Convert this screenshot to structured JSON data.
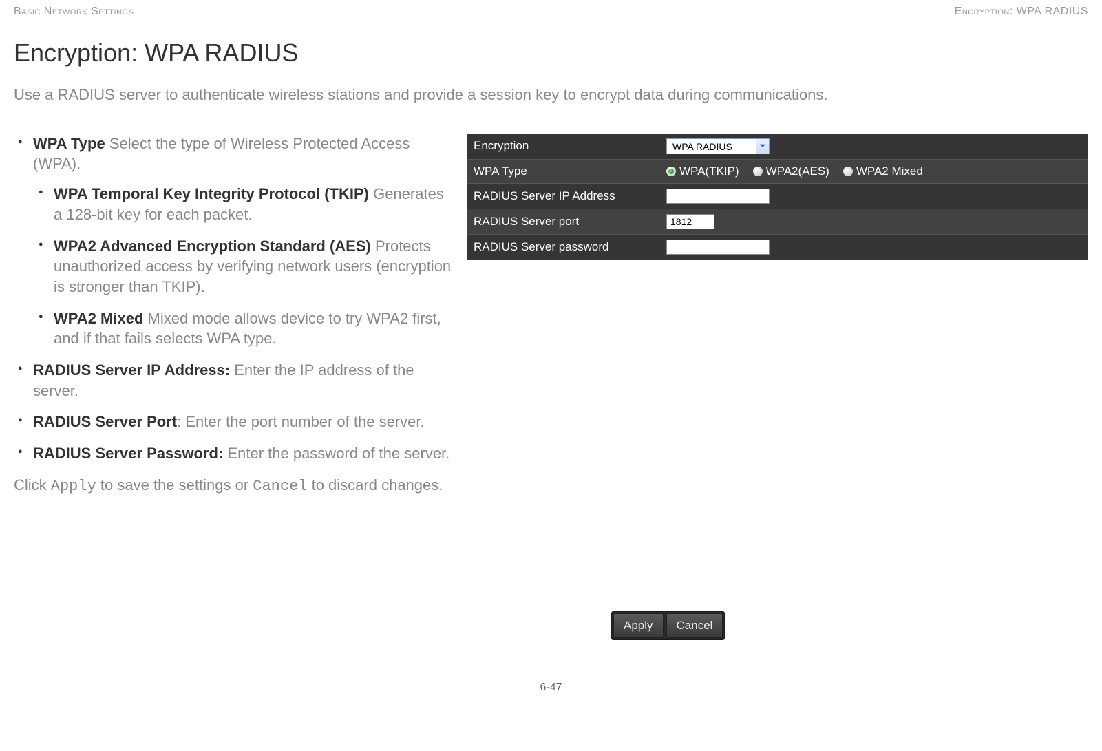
{
  "header": {
    "left": "Basic Network Settings",
    "right": "Encryption: WPA RADIUS"
  },
  "title": "Encryption: WPA RADIUS",
  "intro": "Use a RADIUS server to authenticate wireless stations and provide a session key to encrypt data during communications.",
  "bullets": {
    "wpaType": {
      "term": "WPA Type",
      "desc": "  Select the type of Wireless Protected Access (WPA).",
      "sub": {
        "tkip": {
          "term": "WPA Temporal Key Integrity Protocol (TKIP)",
          "desc": "  Generates a 128-bit key for each packet."
        },
        "aes": {
          "term": "WPA2 Advanced Encryption Standard (AES)",
          "desc": "  Protects unauthorized access by verifying network users (encryption is stronger than TKIP)."
        },
        "mixed": {
          "term": "WPA2 Mixed",
          "desc": "  Mixed mode allows device to try WPA2 first, and if that fails selects WPA type."
        }
      }
    },
    "ip": {
      "term": "RADIUS Server IP Address:",
      "desc": " Enter the IP address of the server."
    },
    "port": {
      "term": "RADIUS Server Port",
      "desc": ": Enter the port number of the server."
    },
    "password": {
      "term": "RADIUS Server Password:",
      "desc": " Enter the password of the server."
    }
  },
  "closing": {
    "pre": "Click ",
    "apply": "Apply",
    "mid": " to save the settings or ",
    "cancel": "Cancel",
    "post": " to discard changes."
  },
  "panel": {
    "rows": {
      "encryption": {
        "label": "Encryption",
        "value": "WPA RADIUS"
      },
      "wpaType": {
        "label": "WPA Type",
        "options": {
          "tkip": "WPA(TKIP)",
          "aes": "WPA2(AES)",
          "mixed": "WPA2 Mixed"
        }
      },
      "ip": {
        "label": "RADIUS Server IP Address",
        "value": ""
      },
      "port": {
        "label": "RADIUS Server port",
        "value": "1812"
      },
      "password": {
        "label": "RADIUS Server password",
        "value": ""
      }
    }
  },
  "buttons": {
    "apply": "Apply",
    "cancel": "Cancel"
  },
  "pageNumber": "6-47"
}
